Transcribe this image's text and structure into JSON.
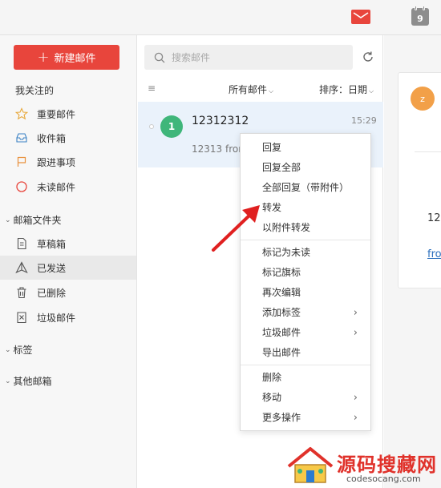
{
  "sidebar": {
    "compose_label": "新建邮件",
    "favorites_title": "我关注的",
    "favorites": [
      {
        "label": "重要邮件",
        "icon": "star-icon"
      },
      {
        "label": "收件箱",
        "icon": "inbox-icon"
      },
      {
        "label": "跟进事项",
        "icon": "flag-icon"
      },
      {
        "label": "未读邮件",
        "icon": "circle-icon"
      }
    ],
    "folders_title": "邮箱文件夹",
    "folders": [
      {
        "label": "草稿箱",
        "icon": "draft-icon"
      },
      {
        "label": "已发送",
        "icon": "sent-icon",
        "active": true
      },
      {
        "label": "已删除",
        "icon": "trash-icon"
      },
      {
        "label": "垃圾邮件",
        "icon": "spam-icon"
      }
    ],
    "tags_title": "标签",
    "other_title": "其他邮箱"
  },
  "list": {
    "search_placeholder": "搜索邮件",
    "filter_label": "所有邮件",
    "sort_label": "排序：日期",
    "mail": {
      "avatar_text": "1",
      "sender": "12312312",
      "time": "15:29",
      "preview": "12313 from"
    }
  },
  "reader": {
    "avatar_text": "z",
    "text1": "12:",
    "text2": "fro"
  },
  "context_menu": {
    "groups": [
      [
        {
          "label": "回复"
        },
        {
          "label": "回复全部"
        },
        {
          "label": "全部回复（带附件）"
        },
        {
          "label": "转发"
        },
        {
          "label": "以附件转发"
        }
      ],
      [
        {
          "label": "标记为未读"
        },
        {
          "label": "标记旗标"
        },
        {
          "label": "再次编辑"
        },
        {
          "label": "添加标签",
          "submenu": true
        },
        {
          "label": "垃圾邮件",
          "submenu": true
        },
        {
          "label": "导出邮件"
        }
      ],
      [
        {
          "label": "删除"
        },
        {
          "label": "移动",
          "submenu": true
        },
        {
          "label": "更多操作",
          "submenu": true
        }
      ]
    ]
  },
  "topbar": {
    "calendar_day": "9"
  },
  "watermark": {
    "title": "源码搜藏网",
    "url": "codesocang.com"
  },
  "colors": {
    "accent": "#e8453c",
    "selected_row": "#eaf2fb",
    "avatar_green": "#3fb67a",
    "avatar_orange": "#f2a048"
  }
}
